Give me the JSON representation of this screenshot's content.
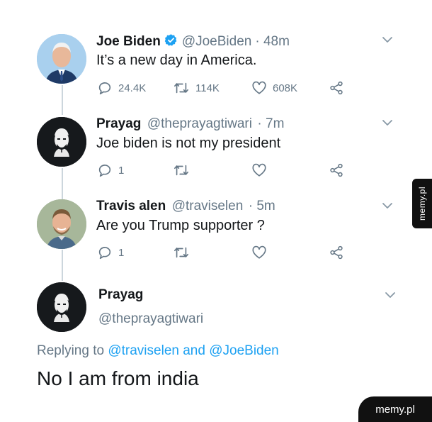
{
  "tweets": [
    {
      "name": "Joe Biden",
      "handle": "@JoeBiden",
      "time": "· 48m",
      "text": "It’s a new day in America.",
      "verified": true,
      "replies": "24.4K",
      "retweets": "114K",
      "likes": "608K"
    },
    {
      "name": "Prayag",
      "handle": "@theprayagtiwari",
      "time": "· 7m",
      "text": "Joe biden is not my president",
      "replies": "1",
      "retweets": "",
      "likes": ""
    },
    {
      "name": "Travis alen",
      "handle": "@traviselen",
      "time": "· 5m",
      "text": "Are you Trump supporter ?",
      "replies": "1",
      "retweets": "",
      "likes": ""
    }
  ],
  "focused": {
    "name": "Prayag",
    "handle": "@theprayagtiwari",
    "replying_prefix": "Replying to",
    "replying_user1": "@traviselen",
    "replying_and": "and",
    "replying_user2": "@JoeBiden",
    "text": "No I am from india"
  },
  "watermark": "memy.pl",
  "colors": {
    "link": "#1da1f2",
    "verified": "#1da1f2",
    "muted": "#657786",
    "thread_line": "#ccd6dd"
  },
  "icons": [
    "reply-icon",
    "retweet-icon",
    "like-icon",
    "share-icon",
    "chevron-down-icon",
    "verified-badge-icon"
  ]
}
